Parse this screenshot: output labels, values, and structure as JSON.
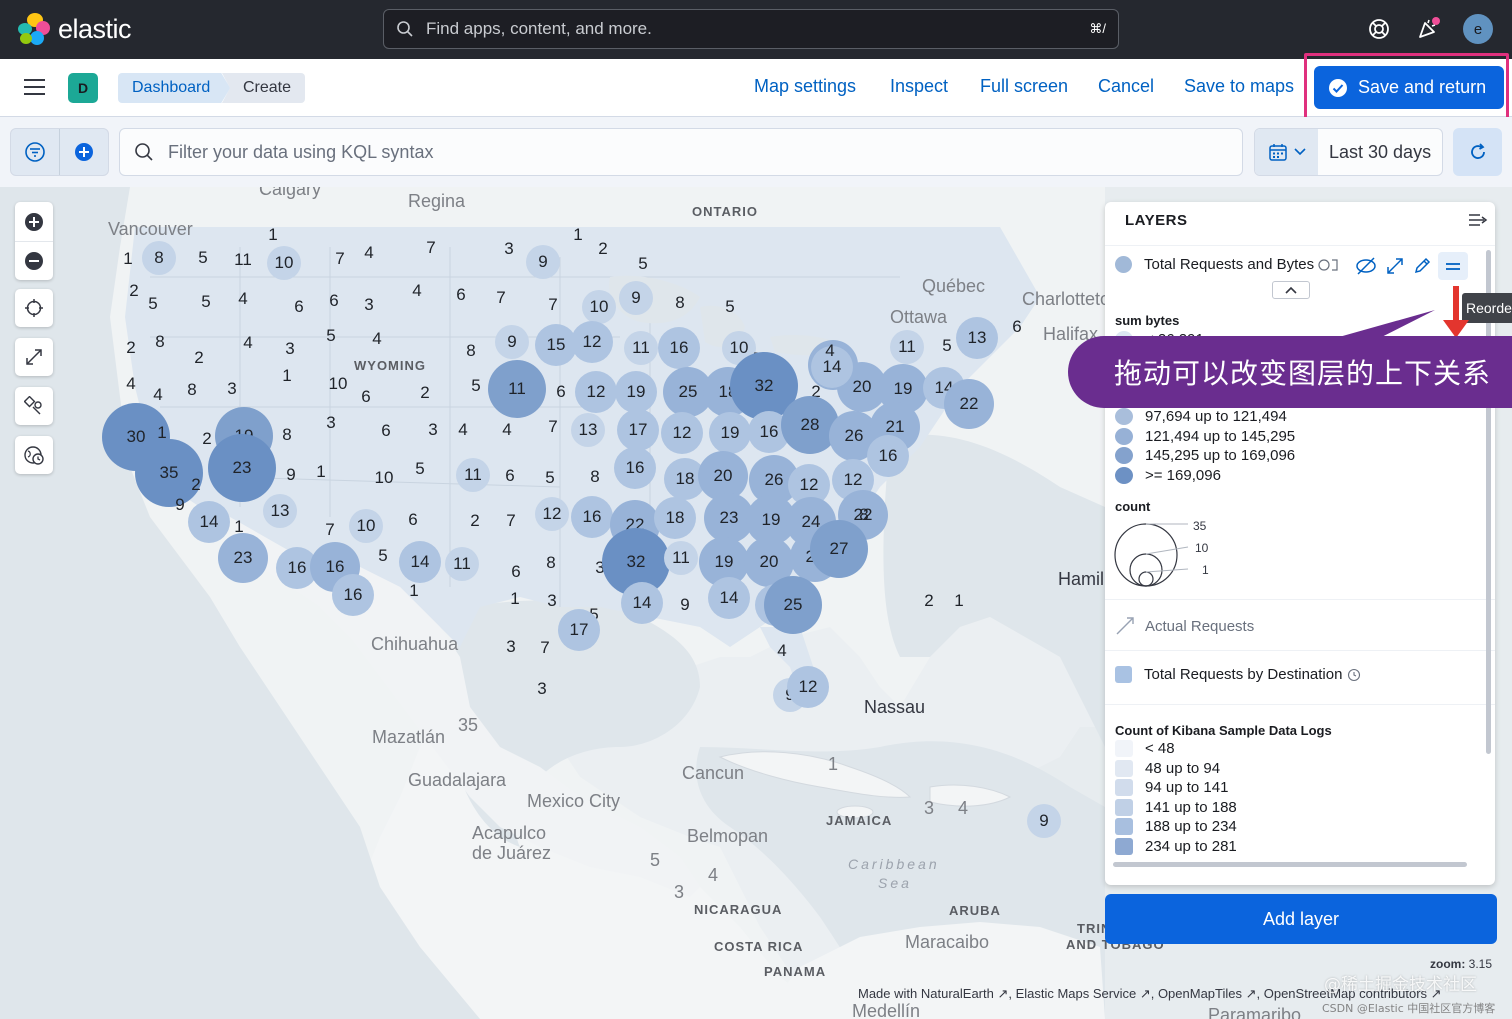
{
  "header": {
    "brand": "elastic",
    "search_placeholder": "Find apps, content, and more.",
    "search_shortcut": "⌘/",
    "avatar_initial": "e"
  },
  "subbar": {
    "space_initial": "D",
    "breadcrumbs": [
      "Dashboard",
      "Create"
    ],
    "links": [
      "Map settings",
      "Inspect",
      "Full screen",
      "Cancel",
      "Save to maps"
    ],
    "primary_button": "Save and return"
  },
  "querybar": {
    "kql_placeholder": "Filter your data using KQL syntax",
    "time_range": "Last 30 days"
  },
  "map": {
    "labels": [
      {
        "text": "Calgary",
        "cls": "city"
      },
      {
        "text": "Regina",
        "cls": "city"
      },
      {
        "text": "ONTARIO",
        "cls": "caps"
      },
      {
        "text": "Vancouver",
        "cls": "city"
      },
      {
        "text": "Québec",
        "cls": "city"
      },
      {
        "text": "Charlotteto",
        "cls": "city"
      },
      {
        "text": "Ottawa",
        "cls": "city"
      },
      {
        "text": "Halifax",
        "cls": "city"
      },
      {
        "text": "WYOMING",
        "cls": "caps"
      },
      {
        "text": "Chihuahua",
        "cls": "city"
      },
      {
        "text": "Mazatlán",
        "cls": "city"
      },
      {
        "text": "Guadalajara",
        "cls": "city"
      },
      {
        "text": "Mexico City",
        "cls": "city"
      },
      {
        "text": "Acapulco",
        "cls": "city"
      },
      {
        "text": "de Juárez",
        "cls": "city"
      },
      {
        "text": "Cancun",
        "cls": "city"
      },
      {
        "text": "Belmopan",
        "cls": "city"
      },
      {
        "text": "Nassau",
        "cls": "city dark"
      },
      {
        "text": "JAMAICA",
        "cls": "caps"
      },
      {
        "text": "Caribbean",
        "cls": "sea"
      },
      {
        "text": "Sea",
        "cls": "sea"
      },
      {
        "text": "NICARAGUA",
        "cls": "caps"
      },
      {
        "text": "ARUBA",
        "cls": "caps"
      },
      {
        "text": "COSTA RICA",
        "cls": "caps"
      },
      {
        "text": "Maracaibo",
        "cls": "city"
      },
      {
        "text": "PANAMA",
        "cls": "caps"
      },
      {
        "text": "Medellín",
        "cls": "city"
      },
      {
        "text": "Paramaribo",
        "cls": "city"
      },
      {
        "text": "Hamil",
        "cls": "city dark"
      },
      {
        "text": "TRIN",
        "cls": "caps"
      },
      {
        "text": "AND TOBAGO",
        "cls": "caps"
      },
      {
        "text": "35",
        "cls": "city"
      },
      {
        "text": "1",
        "cls": "city"
      },
      {
        "text": "3",
        "cls": "city"
      },
      {
        "text": "4",
        "cls": "city"
      },
      {
        "text": "5",
        "cls": "city"
      },
      {
        "text": "4",
        "cls": "city"
      },
      {
        "text": "3",
        "cls": "city"
      }
    ],
    "clusters": [
      {
        "n": "8",
        "s": 1
      },
      {
        "n": "5",
        "s": 0
      },
      {
        "n": "11",
        "s": 0
      },
      {
        "n": "10",
        "s": 1
      },
      {
        "n": "7",
        "s": 0
      },
      {
        "n": "4",
        "s": 0
      },
      {
        "n": "7",
        "s": 0
      },
      {
        "n": "3",
        "s": 0
      },
      {
        "n": "9",
        "s": 1
      },
      {
        "n": "1",
        "s": 0
      },
      {
        "n": "2",
        "s": 0
      },
      {
        "n": "5",
        "s": 0
      },
      {
        "n": "1",
        "s": 0
      },
      {
        "n": "1",
        "s": 0
      },
      {
        "n": "2",
        "s": 0
      },
      {
        "n": "5",
        "s": 0
      },
      {
        "n": "5",
        "s": 0
      },
      {
        "n": "4",
        "s": 0
      },
      {
        "n": "6",
        "s": 0
      },
      {
        "n": "6",
        "s": 0
      },
      {
        "n": "3",
        "s": 0
      },
      {
        "n": "4",
        "s": 0
      },
      {
        "n": "6",
        "s": 0
      },
      {
        "n": "7",
        "s": 0
      },
      {
        "n": "7",
        "s": 0
      },
      {
        "n": "10",
        "s": 1
      },
      {
        "n": "9",
        "s": 1
      },
      {
        "n": "8",
        "s": 0
      },
      {
        "n": "5",
        "s": 0
      },
      {
        "n": "2",
        "s": 0
      },
      {
        "n": "4",
        "s": 0
      },
      {
        "n": "8",
        "s": 0
      },
      {
        "n": "2",
        "s": 0
      },
      {
        "n": "4",
        "s": 0
      },
      {
        "n": "3",
        "s": 0
      },
      {
        "n": "5",
        "s": 0
      },
      {
        "n": "4",
        "s": 0
      },
      {
        "n": "8",
        "s": 0
      },
      {
        "n": "9",
        "s": 1
      },
      {
        "n": "15",
        "s": 2
      },
      {
        "n": "12",
        "s": 2
      },
      {
        "n": "11",
        "s": 1
      },
      {
        "n": "16",
        "s": 2
      },
      {
        "n": "10",
        "s": 1
      },
      {
        "n": "7",
        "s": 0
      },
      {
        "n": "4",
        "s": 0
      },
      {
        "n": "8",
        "s": 0
      },
      {
        "n": "3",
        "s": 0
      },
      {
        "n": "1",
        "s": 0
      },
      {
        "n": "10",
        "s": 0
      },
      {
        "n": "6",
        "s": 0
      },
      {
        "n": "2",
        "s": 0
      },
      {
        "n": "5",
        "s": 0
      },
      {
        "n": "11",
        "s": 4
      },
      {
        "n": "6",
        "s": 0
      },
      {
        "n": "12",
        "s": 2
      },
      {
        "n": "19",
        "s": 2
      },
      {
        "n": "25",
        "s": 3
      },
      {
        "n": "18",
        "s": 3
      },
      {
        "n": "32",
        "s": 5
      },
      {
        "n": "20",
        "s": 3
      },
      {
        "n": "2",
        "s": 0
      },
      {
        "n": "20",
        "s": 3
      },
      {
        "n": "11",
        "s": 1
      },
      {
        "n": "5",
        "s": 0
      },
      {
        "n": "13",
        "s": 2
      },
      {
        "n": "19",
        "s": 3
      },
      {
        "n": "14",
        "s": 2
      },
      {
        "n": "22",
        "s": 3
      },
      {
        "n": "30",
        "s": 5
      },
      {
        "n": "1",
        "s": 0
      },
      {
        "n": "2",
        "s": 0
      },
      {
        "n": "19",
        "s": 4
      },
      {
        "n": "8",
        "s": 0
      },
      {
        "n": "3",
        "s": 0
      },
      {
        "n": "6",
        "s": 0
      },
      {
        "n": "3",
        "s": 0
      },
      {
        "n": "4",
        "s": 0
      },
      {
        "n": "4",
        "s": 0
      },
      {
        "n": "7",
        "s": 0
      },
      {
        "n": "13",
        "s": 1
      },
      {
        "n": "17",
        "s": 2
      },
      {
        "n": "12",
        "s": 2
      },
      {
        "n": "19",
        "s": 2
      },
      {
        "n": "16",
        "s": 2
      },
      {
        "n": "28",
        "s": 4
      },
      {
        "n": "26",
        "s": 3
      },
      {
        "n": "21",
        "s": 3
      },
      {
        "n": "16",
        "s": 2
      },
      {
        "n": "35",
        "s": 5
      },
      {
        "n": "2",
        "s": 0
      },
      {
        "n": "23",
        "s": 5
      },
      {
        "n": "9",
        "s": 0
      },
      {
        "n": "1",
        "s": 0
      },
      {
        "n": "10",
        "s": 0
      },
      {
        "n": "5",
        "s": 0
      },
      {
        "n": "11",
        "s": 1
      },
      {
        "n": "6",
        "s": 0
      },
      {
        "n": "5",
        "s": 0
      },
      {
        "n": "8",
        "s": 0
      },
      {
        "n": "16",
        "s": 2
      },
      {
        "n": "18",
        "s": 2
      },
      {
        "n": "20",
        "s": 3
      },
      {
        "n": "26",
        "s": 3
      },
      {
        "n": "12",
        "s": 2
      },
      {
        "n": "12",
        "s": 2
      },
      {
        "n": "9",
        "s": 0
      },
      {
        "n": "14",
        "s": 2
      },
      {
        "n": "1",
        "s": 0
      },
      {
        "n": "13",
        "s": 1
      },
      {
        "n": "7",
        "s": 0
      },
      {
        "n": "10",
        "s": 1
      },
      {
        "n": "6",
        "s": 0
      },
      {
        "n": "2",
        "s": 0
      },
      {
        "n": "7",
        "s": 0
      },
      {
        "n": "12",
        "s": 1
      },
      {
        "n": "16",
        "s": 2
      },
      {
        "n": "22",
        "s": 3
      },
      {
        "n": "18",
        "s": 2
      },
      {
        "n": "23",
        "s": 3
      },
      {
        "n": "19",
        "s": 3
      },
      {
        "n": "24",
        "s": 3
      },
      {
        "n": "22",
        "s": 3
      },
      {
        "n": "23",
        "s": 3
      },
      {
        "n": "16",
        "s": 2
      },
      {
        "n": "16",
        "s": 3
      },
      {
        "n": "5",
        "s": 0
      },
      {
        "n": "14",
        "s": 2
      },
      {
        "n": "11",
        "s": 1
      },
      {
        "n": "6",
        "s": 0
      },
      {
        "n": "8",
        "s": 0
      },
      {
        "n": "3",
        "s": 0
      },
      {
        "n": "32",
        "s": 5
      },
      {
        "n": "11",
        "s": 1
      },
      {
        "n": "19",
        "s": 3
      },
      {
        "n": "20",
        "s": 3
      },
      {
        "n": "21",
        "s": 3
      },
      {
        "n": "27",
        "s": 4
      },
      {
        "n": "16",
        "s": 2
      },
      {
        "n": "1",
        "s": 0
      },
      {
        "n": "1",
        "s": 0
      },
      {
        "n": "3",
        "s": 0
      },
      {
        "n": "5",
        "s": 0
      },
      {
        "n": "14",
        "s": 2
      },
      {
        "n": "9",
        "s": 0
      },
      {
        "n": "14",
        "s": 2
      },
      {
        "n": "17",
        "s": 2
      },
      {
        "n": "25",
        "s": 4
      },
      {
        "n": "17",
        "s": 2
      },
      {
        "n": "7",
        "s": 0
      },
      {
        "n": "4",
        "s": 0
      },
      {
        "n": "3",
        "s": 0
      },
      {
        "n": "9",
        "s": 1
      },
      {
        "n": "12",
        "s": 2
      },
      {
        "n": "3",
        "s": 0
      },
      {
        "n": "9",
        "s": 1
      },
      {
        "n": "6",
        "s": 0
      },
      {
        "n": "14",
        "s": 2
      },
      {
        "n": "1",
        "s": 0
      },
      {
        "n": "2",
        "s": 0
      },
      {
        "n": "4",
        "s": 0
      },
      {
        "n": "8",
        "s": 0
      },
      {
        "n": "5",
        "s": 0
      },
      {
        "n": "1",
        "s": 0
      },
      {
        "n": "2",
        "s": 0
      },
      {
        "n": "4",
        "s": 0
      },
      {
        "n": "16",
        "s": 2
      }
    ],
    "zoom_label": "zoom:",
    "zoom_value": "3.15",
    "attribution": "Made with NaturalEarth ↗, Elastic Maps Service ↗, OpenMapTiles ↗, OpenStreetMap contributors ↗"
  },
  "layers_panel": {
    "title": "LAYERS",
    "layer1": "Total Requests and Bytes",
    "sum_bytes_label": "sum bytes",
    "sum_bytes_partial": "< 26,291",
    "bytes_legend": [
      "97,694 up to 121,494",
      "121,494 up to 145,295",
      "145,295 up to 169,096",
      ">= 169,096"
    ],
    "count_label": "count",
    "count_sizes": [
      "35",
      "10",
      "1"
    ],
    "layer2": "Actual Requests",
    "layer3": "Total Requests by Destination",
    "count_logs_label": "Count of Kibana Sample Data Logs",
    "logs_legend": [
      "< 48",
      "48 up to 94",
      "94 up to 141",
      "141 up to 188",
      "188 up to 234",
      "234 up to 281"
    ],
    "add_layer": "Add layer",
    "tooltip": "Reorder"
  },
  "annotation": {
    "callout": "拖动可以改变图层的上下关系"
  },
  "watermark": {
    "line1": "@稀土掘金技术社区",
    "line2": "CSDN @Elastic 中国社区官方博客"
  },
  "colors": {
    "header_bg": "#25282f",
    "primary": "#0b64dd",
    "link": "#0061c2",
    "highlight_border": "#e0307e",
    "callout_bg": "#6a2d8f",
    "cluster_scale": [
      "#d9e3ef",
      "#c4d4e8",
      "#aec4e1",
      "#98b3d8",
      "#7fa0cc",
      "#6a90c4"
    ]
  }
}
